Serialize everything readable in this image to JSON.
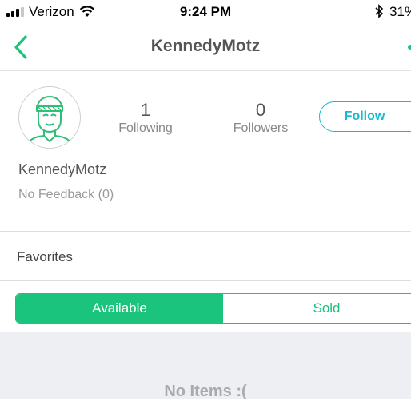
{
  "status_bar": {
    "carrier": "Verizon",
    "time": "9:24 PM",
    "battery": "31%"
  },
  "nav": {
    "title": "KennedyMotz"
  },
  "profile": {
    "following_count": "1",
    "following_label": "Following",
    "followers_count": "0",
    "followers_label": "Followers",
    "follow_label": "Follow",
    "username": "KennedyMotz",
    "feedback": "No Feedback (0)"
  },
  "favorites_label": "Favorites",
  "tabs": [
    {
      "label": "Available",
      "selected": true
    },
    {
      "label": "Sold",
      "selected": false
    }
  ],
  "empty_message": "No Items :(",
  "colors": {
    "accent_green": "#1bc47d",
    "follow_cyan": "#12bcd0",
    "background_gray": "#eeeff3"
  },
  "icons": [
    "signal-bars-icon",
    "wifi-icon",
    "back-chevron-icon",
    "bluetooth-icon",
    "avatar-icon"
  ]
}
